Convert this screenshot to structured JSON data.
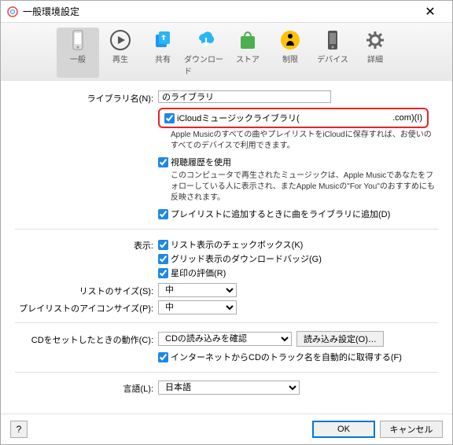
{
  "window": {
    "title": "一般環境設定"
  },
  "toolbar": [
    {
      "label": "一般"
    },
    {
      "label": "再生"
    },
    {
      "label": "共有"
    },
    {
      "label": "ダウンロード"
    },
    {
      "label": "ストア"
    },
    {
      "label": "制限"
    },
    {
      "label": "デバイス"
    },
    {
      "label": "詳細"
    }
  ],
  "library": {
    "name_label": "ライブラリ名(N):",
    "name_value": "のライブラリ",
    "icloud_label": "iCloudミュージックライブラリ(",
    "icloud_suffix": ".com)(I)",
    "icloud_desc": "Apple Musicのすべての曲やプレイリストをiCloudに保存すれば、お使いのすべてのデバイスで利用できます。",
    "history_label": "視聴履歴を使用",
    "history_desc": "このコンピュータで再生されたミュージックは、Apple Musicであなたをフォローしている人に表示され、またApple Musicの\"For You\"のおすすめにも反映されます。",
    "addplaylist_label": "プレイリストに追加するときに曲をライブラリに追加(D)"
  },
  "display": {
    "label": "表示:",
    "listcheck_label": "リスト表示のチェックボックス(K)",
    "gridbadge_label": "グリッド表示のダウンロードバッジ(G)",
    "star_label": "星印の評価(R)"
  },
  "listsize": {
    "label": "リストのサイズ(S):",
    "value": "中"
  },
  "iconsize": {
    "label": "プレイリストのアイコンサイズ(P):",
    "value": "中"
  },
  "cd": {
    "label": "CDをセットしたときの動作(C):",
    "value": "CDの読み込みを確認",
    "settings_btn": "読み込み設定(O)…",
    "internet_label": "インターネットからCDのトラック名を自動的に取得する(F)"
  },
  "language": {
    "label": "言語(L):",
    "value": "日本語"
  },
  "footer": {
    "help": "?",
    "ok": "OK",
    "cancel": "キャンセル"
  }
}
